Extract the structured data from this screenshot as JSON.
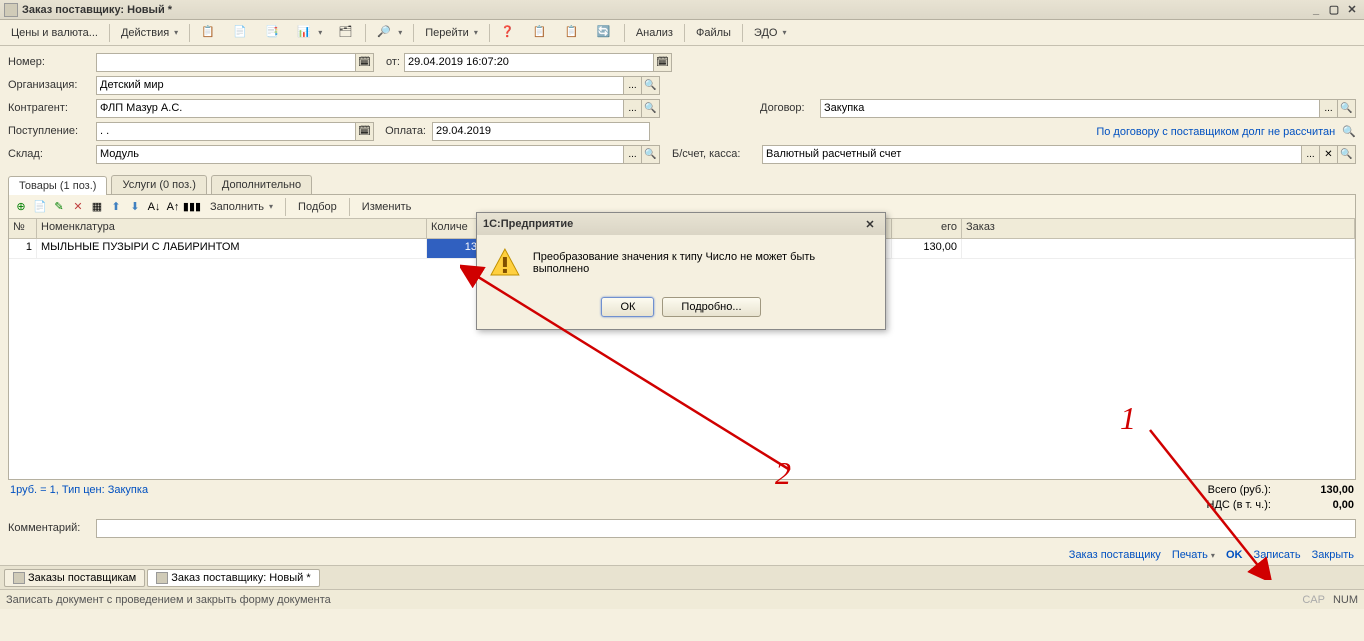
{
  "window": {
    "title": "Заказ поставщику: Новый *",
    "min": "_",
    "max": "▢",
    "close": "✕"
  },
  "toolbar": {
    "prices": "Цены и валюта...",
    "actions": "Действия",
    "goto": "Перейти",
    "analysis": "Анализ",
    "files": "Файлы",
    "edo": "ЭДО"
  },
  "form": {
    "number_label": "Номер:",
    "from_label": "от:",
    "date_value": "29.04.2019 16:07:20",
    "org_label": "Организация:",
    "org_value": "Детский мир",
    "contr_label": "Контрагент:",
    "contr_value": "ФЛП Мазур А.С.",
    "contract_label": "Договор:",
    "contract_value": "Закупка",
    "receipt_label": "Поступление:",
    "receipt_value": ". .",
    "payment_label": "Оплата:",
    "payment_value": "29.04.2019",
    "debt_link": "По договору с поставщиком долг не рассчитан",
    "warehouse_label": "Склад:",
    "warehouse_value": "Модуль",
    "account_label": "Б/счет, касса:",
    "account_value": "Валютный расчетный счет"
  },
  "tabs": {
    "goods": "Товары (1 поз.)",
    "services": "Услуги (0 поз.)",
    "extra": "Дополнительно"
  },
  "grid_toolbar": {
    "fill": "Заполнить",
    "select": "Подбор",
    "change": "Изменить"
  },
  "grid": {
    "cols": {
      "n": "№",
      "nom": "Номенклатура",
      "qty": "Количе",
      "price": "его",
      "order": "Заказ"
    },
    "row": {
      "n": "1",
      "nom": "МЫЛЬНЫЕ ПУЗЫРИ С ЛАБИРИНТОМ",
      "qty": "13",
      "price": "130,00"
    }
  },
  "price_info": "1руб. = 1, Тип цен: Закупка",
  "totals": {
    "total_label": "Всего (руб.):",
    "total_value": "130,00",
    "vat_label": "НДС (в т. ч.):",
    "vat_value": "0,00"
  },
  "comment_label": "Комментарий:",
  "bottom": {
    "order": "Заказ поставщику",
    "print": "Печать",
    "ok": "OK",
    "save": "Записать",
    "close": "Закрыть"
  },
  "wintabs": {
    "list": "Заказы поставщикам",
    "doc": "Заказ поставщику: Новый *"
  },
  "status": {
    "hint": "Записать документ с проведением и закрыть форму документа",
    "cap": "CAP",
    "num": "NUM"
  },
  "dialog": {
    "title": "1С:Предприятие",
    "message": "Преобразование значения к типу Число не может быть выполнено",
    "ok": "ОК",
    "details": "Подробно..."
  },
  "annotations": {
    "a1": "1",
    "a2": "2"
  }
}
